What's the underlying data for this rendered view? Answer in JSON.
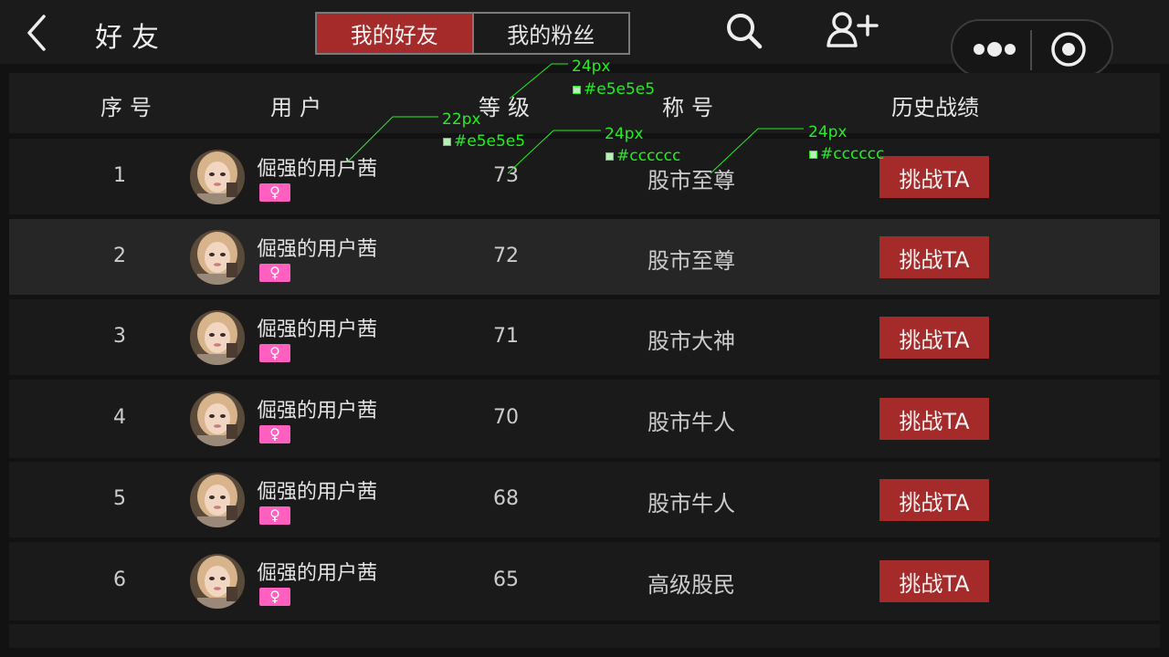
{
  "header": {
    "title": "好友",
    "tabs": [
      {
        "label": "我的好友",
        "active": true
      },
      {
        "label": "我的粉丝",
        "active": false
      }
    ],
    "icons": [
      "back-icon",
      "search-icon",
      "add-user-icon",
      "more-icon",
      "target-icon"
    ]
  },
  "table": {
    "headers": {
      "index": "序号",
      "user": "用户",
      "level": "等级",
      "title": "称号",
      "history": "历史战绩"
    },
    "rows": [
      {
        "index": "1",
        "name": "倔强的用户茜",
        "gender": "♀",
        "level": "73",
        "title": "股市至尊",
        "action": "挑战TA"
      },
      {
        "index": "2",
        "name": "倔强的用户茜",
        "gender": "♀",
        "level": "72",
        "title": "股市至尊",
        "action": "挑战TA"
      },
      {
        "index": "3",
        "name": "倔强的用户茜",
        "gender": "♀",
        "level": "71",
        "title": "股市大神",
        "action": "挑战TA"
      },
      {
        "index": "4",
        "name": "倔强的用户茜",
        "gender": "♀",
        "level": "70",
        "title": "股市牛人",
        "action": "挑战TA"
      },
      {
        "index": "5",
        "name": "倔强的用户茜",
        "gender": "♀",
        "level": "68",
        "title": "股市牛人",
        "action": "挑战TA"
      },
      {
        "index": "6",
        "name": "倔强的用户茜",
        "gender": "♀",
        "level": "65",
        "title": "高级股民",
        "action": "挑战TA"
      }
    ]
  },
  "annotations": [
    {
      "size": "24px",
      "color": "#e5e5e5"
    },
    {
      "size": "22px",
      "color": "#e5e5e5"
    },
    {
      "size": "24px",
      "color": "#cccccc"
    },
    {
      "size": "24px",
      "color": "#cccccc"
    }
  ],
  "colors": {
    "accent": "#a52a2a",
    "gender_badge": "#ff5fbf",
    "annotation": "#22ee22",
    "text_primary": "#e5e5e5",
    "text_secondary": "#cccccc"
  }
}
